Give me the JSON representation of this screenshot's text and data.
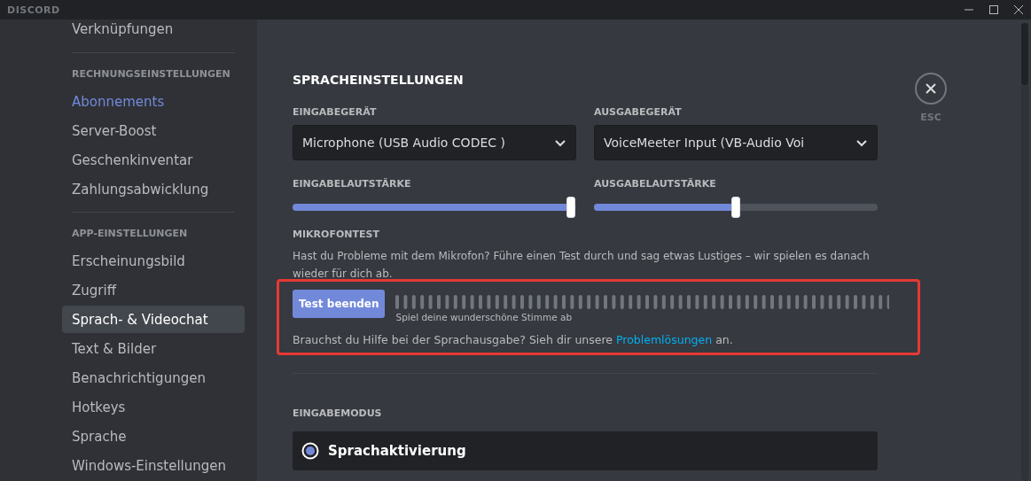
{
  "window": {
    "title": "DISCORD"
  },
  "sidebar": {
    "items": [
      {
        "kind": "item",
        "label": "Verknüpfungen",
        "selected": false
      },
      {
        "kind": "divider"
      },
      {
        "kind": "header",
        "label": "RECHNUNGSEINSTELLUNGEN"
      },
      {
        "kind": "accent",
        "label": "Abonnements",
        "selected": false
      },
      {
        "kind": "item",
        "label": "Server-Boost",
        "selected": false
      },
      {
        "kind": "item",
        "label": "Geschenkinventar",
        "selected": false
      },
      {
        "kind": "item",
        "label": "Zahlungsabwicklung",
        "selected": false
      },
      {
        "kind": "divider"
      },
      {
        "kind": "header",
        "label": "APP-EINSTELLUNGEN"
      },
      {
        "kind": "item",
        "label": "Erscheinungsbild",
        "selected": false
      },
      {
        "kind": "item",
        "label": "Zugriff",
        "selected": false
      },
      {
        "kind": "item",
        "label": "Sprach- & Videochat",
        "selected": true
      },
      {
        "kind": "item",
        "label": "Text & Bilder",
        "selected": false
      },
      {
        "kind": "item",
        "label": "Benachrichtigungen",
        "selected": false
      },
      {
        "kind": "item",
        "label": "Hotkeys",
        "selected": false
      },
      {
        "kind": "item",
        "label": "Sprache",
        "selected": false
      },
      {
        "kind": "item",
        "label": "Windows-Einstellungen",
        "selected": false
      }
    ]
  },
  "content": {
    "title": "SPRACHEINSTELLUNGEN",
    "close": {
      "label": "ESC"
    },
    "devices": [
      {
        "label": "EINGABEGERÄT",
        "value": "Microphone (USB Audio CODEC )"
      },
      {
        "label": "AUSGABEGERÄT",
        "value": "VoiceMeeter Input (VB-Audio Voi"
      }
    ],
    "volumes": [
      {
        "label": "EINGABELAUTSTÄRKE",
        "level": 0.98
      },
      {
        "label": "AUSGABELAUTSTÄRKE",
        "level": 0.5
      }
    ],
    "mic_test": {
      "label": "MIKROFONTEST",
      "description": "Hast du Probleme mit dem Mikrofon? Führe einen Test durch und sag etwas Lustiges – wir spielen es danach wieder für dich ab.",
      "button": "Test beenden",
      "meter_hint": "Spiel deine wunderschöne Stimme ab",
      "help_before": "Brauchst du Hilfe bei der Sprachausgabe? Sieh dir unsere",
      "help_link": "Problemlösungen",
      "help_after": "an.",
      "highlighted": true
    },
    "input_mode": {
      "label": "EINGABEMODUS",
      "options": [
        {
          "label": "Sprachaktivierung",
          "selected": true
        }
      ]
    }
  }
}
